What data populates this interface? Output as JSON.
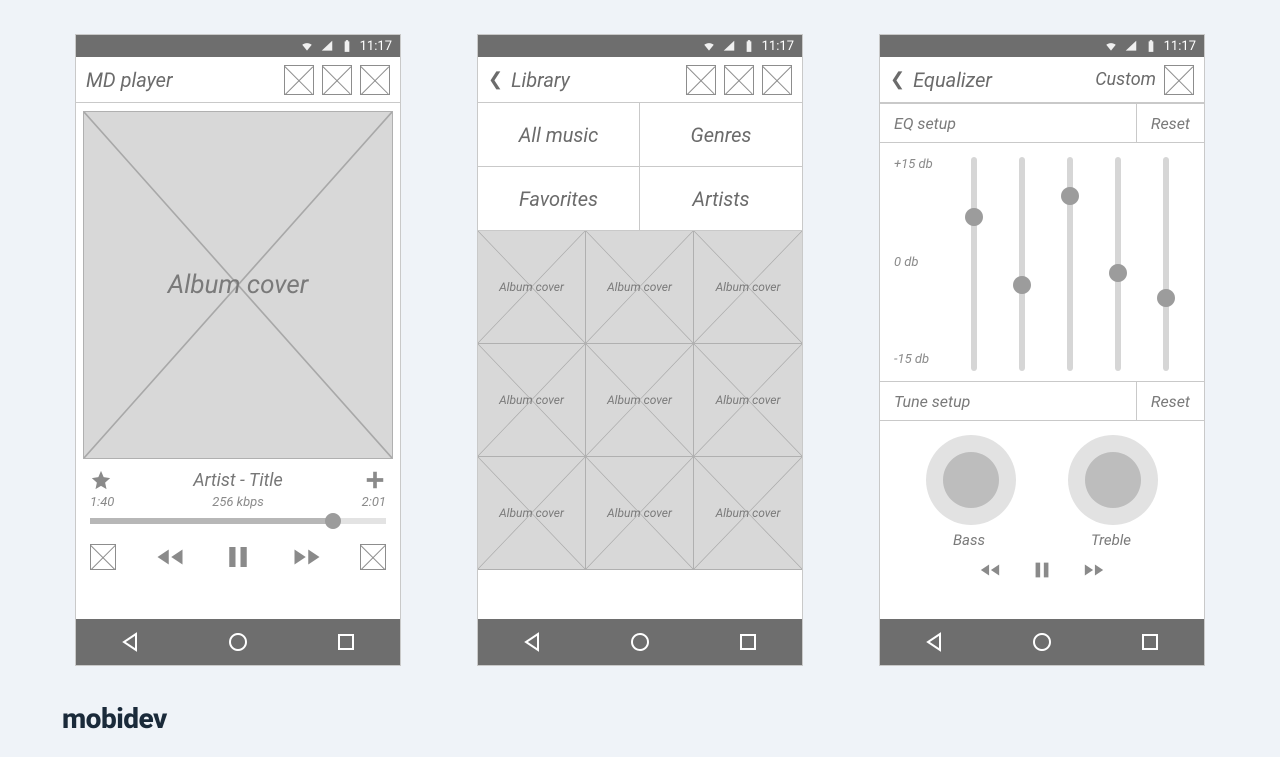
{
  "status": {
    "time": "11:17"
  },
  "logo": "mobidev",
  "player": {
    "title": "MD player",
    "cover_label": "Album cover",
    "track": "Artist - Title",
    "elapsed": "1:40",
    "bitrate": "256 kbps",
    "total": "2:01",
    "progress_pct": 82
  },
  "library": {
    "title": "Library",
    "categories": [
      "All music",
      "Genres",
      "Favorites",
      "Artists"
    ],
    "album_label": "Album cover"
  },
  "equalizer": {
    "title": "Equalizer",
    "preset": "Custom",
    "eq_setup": "EQ setup",
    "reset": "Reset",
    "tune_setup": "Tune setup",
    "scale": {
      "top": "+15 db",
      "mid": "0 db",
      "bot": "-15 db"
    },
    "sliders_pct": [
      28,
      60,
      18,
      54,
      66
    ],
    "bass": "Bass",
    "treble": "Treble"
  }
}
